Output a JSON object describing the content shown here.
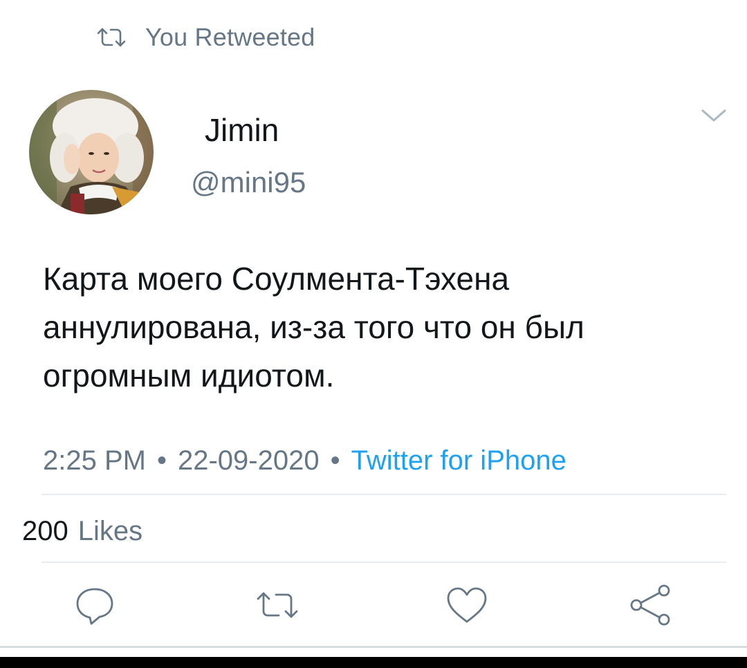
{
  "retweet_banner": {
    "label": "You Retweeted",
    "icon": "retweet-icon"
  },
  "author": {
    "name": "Jimin",
    "handle": "@mini95"
  },
  "tweet": {
    "lines": [
      "Карта моего Соулмента-Тэхена",
      "аннулирована, из-за того что он был",
      "огромным идиотом."
    ]
  },
  "meta": {
    "time": "2:25 PM",
    "separator": "•",
    "date": "22-09-2020",
    "source": "Twitter for iPhone"
  },
  "stats": {
    "likes_count": "200",
    "likes_label": "Likes"
  },
  "actions": {
    "reply_icon": "reply-icon",
    "retweet_icon": "retweet-icon",
    "like_icon": "heart-icon",
    "share_icon": "share-icon"
  },
  "colors": {
    "accent": "#1da1f2",
    "secondary_text": "#657786",
    "primary_text": "#14171a",
    "divider": "#e6ecf0"
  }
}
